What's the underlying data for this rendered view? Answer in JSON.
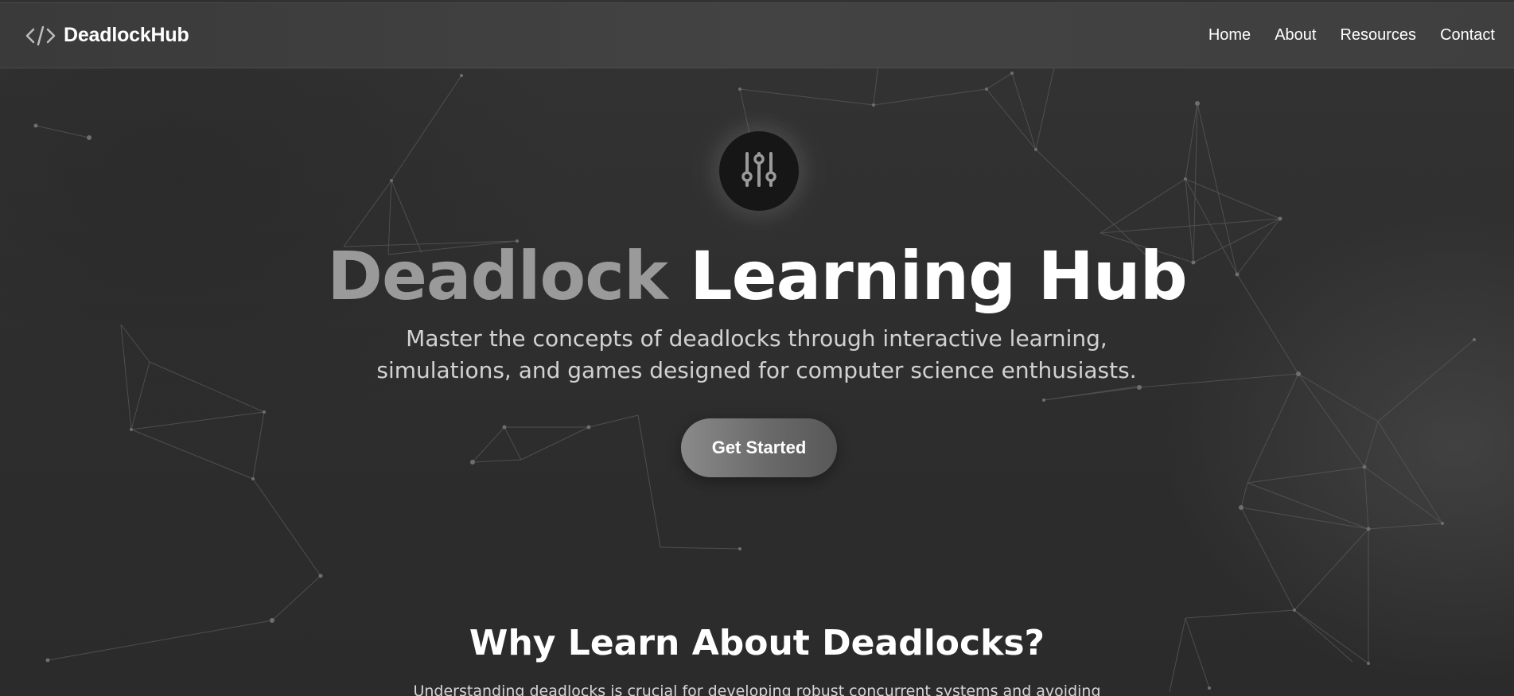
{
  "nav": {
    "brand": "DeadlockHub",
    "brand_icon": "code-icon",
    "links": [
      "Home",
      "About",
      "Resources",
      "Contact"
    ]
  },
  "hero": {
    "icon": "sliders-icon",
    "title_accent": "Deadlock",
    "title_rest": "Learning Hub",
    "subtitle_line1": "Master the concepts of deadlocks through interactive learning,",
    "subtitle_line2": "simulations, and games designed for computer science enthusiasts.",
    "cta_label": "Get Started"
  },
  "section": {
    "title": "Why Learn About Deadlocks?",
    "text": "Understanding deadlocks is crucial for developing robust concurrent systems and avoiding"
  },
  "colors": {
    "background": "#2e2e2e",
    "navbar": "#404040",
    "accent_text": "#9a9a9a",
    "badge": "#161616",
    "button": "#6e6e6e"
  }
}
